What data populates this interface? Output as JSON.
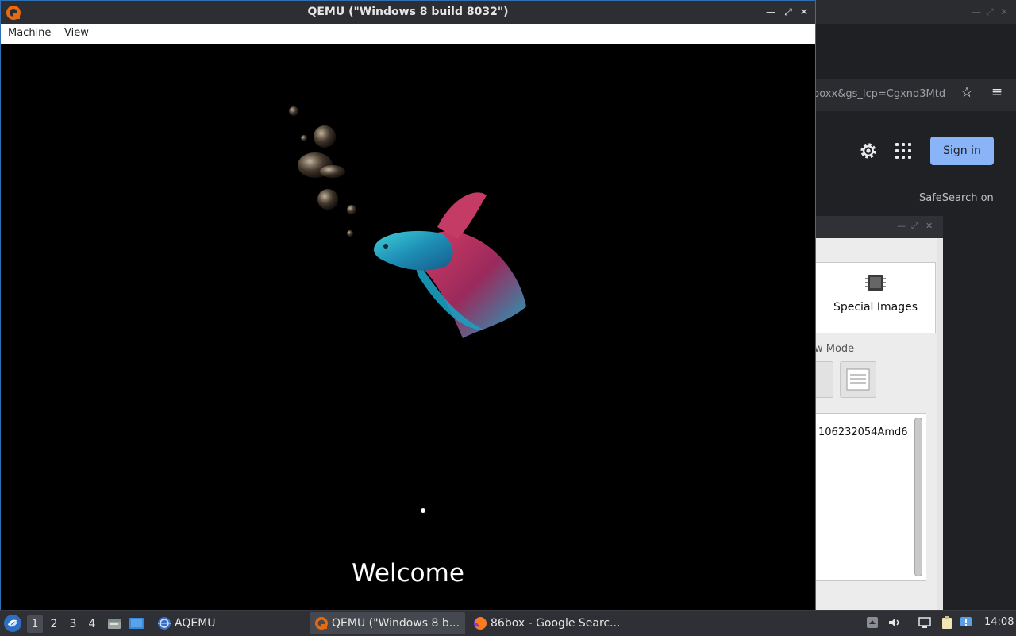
{
  "qemu_window": {
    "title": "QEMU (\"Windows 8 build 8032\")",
    "menu": [
      "Machine",
      "View"
    ],
    "welcome_text": "Welcome"
  },
  "browser_bg": {
    "url_fragment": "boxx&gs_lcp=Cgxnd3Mtd",
    "sign_in_label": "Sign in",
    "safesearch_text": "SafeSearch on"
  },
  "filemanager_bg": {
    "panel_label": "Special Images",
    "view_mode_label": "w Mode",
    "list_item": "106232054Amd6"
  },
  "taskbar": {
    "workspaces": [
      "1",
      "2",
      "3",
      "4"
    ],
    "active_workspace": "1",
    "tasks": [
      {
        "label": "AQEMU",
        "icon": "aqemu-icon"
      },
      {
        "label": "QEMU (\"Windows 8 b...",
        "icon": "qemu-icon"
      },
      {
        "label": "86box - Google Searc...",
        "icon": "firefox-icon"
      }
    ],
    "clock": "14:08"
  },
  "colors": {
    "accent": "#8ab4f8",
    "window_border": "#2f6fb3",
    "taskbar_bg": "#2e3036"
  }
}
